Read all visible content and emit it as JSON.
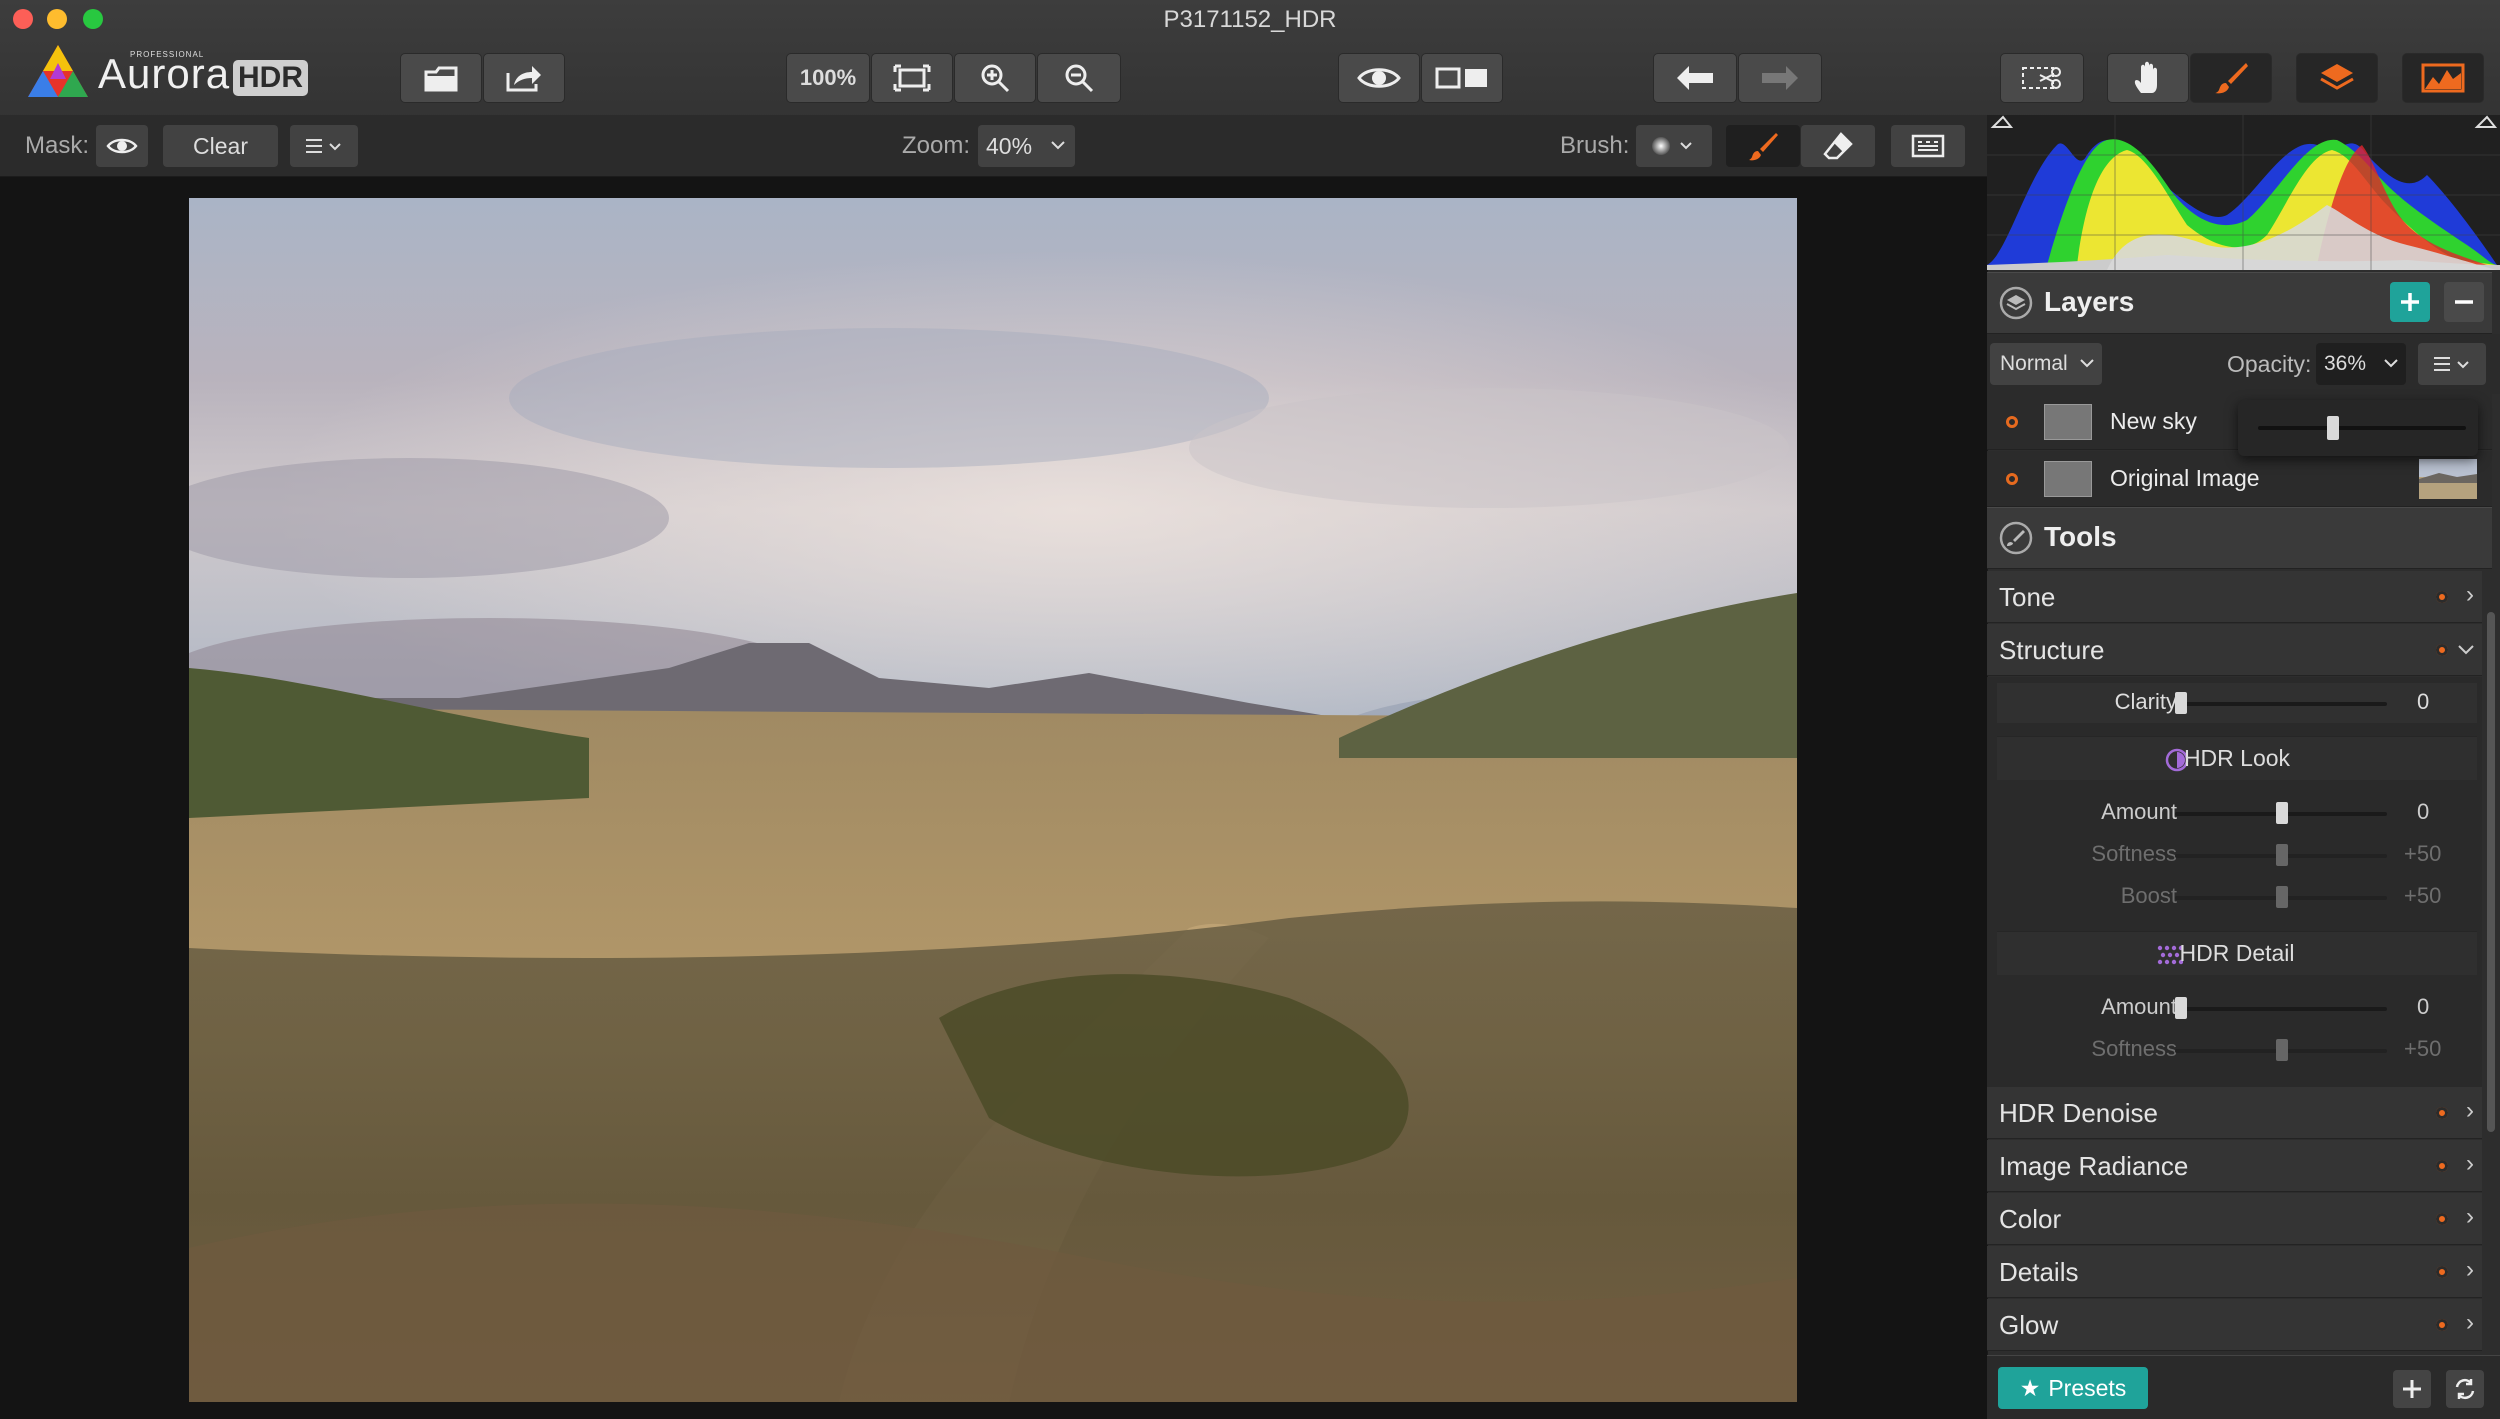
{
  "window": {
    "title": "P3171152_HDR"
  },
  "app": {
    "name": "Aurora",
    "badge": "HDR",
    "edition": "PROFESSIONAL"
  },
  "toolbar": {
    "zoom_100_label": "100%"
  },
  "options_bar": {
    "mask_label": "Mask:",
    "clear_label": "Clear",
    "zoom_label": "Zoom:",
    "zoom_value": "40%",
    "brush_label": "Brush:"
  },
  "layers": {
    "title": "Layers",
    "blend_mode": "Normal",
    "opacity_label": "Opacity:",
    "opacity_value": "36%",
    "opacity_slider_fraction": 0.36,
    "items": [
      {
        "name": "New sky"
      },
      {
        "name": "Original Image"
      }
    ]
  },
  "tools": {
    "title": "Tools",
    "sections": {
      "tone": "Tone",
      "structure": "Structure",
      "hdr_denoise": "HDR Denoise",
      "image_radiance": "Image Radiance",
      "color": "Color",
      "details": "Details",
      "glow": "Glow"
    },
    "structure": {
      "clarity": {
        "label": "Clarity",
        "value": "0"
      },
      "hdr_look": {
        "title": "HDR Look",
        "amount": {
          "label": "Amount",
          "value": "0"
        },
        "softness": {
          "label": "Softness",
          "value": "+50"
        },
        "boost": {
          "label": "Boost",
          "value": "+50"
        }
      },
      "hdr_detail": {
        "title": "HDR Detail",
        "amount": {
          "label": "Amount",
          "value": "0"
        },
        "softness": {
          "label": "Softness",
          "value": "+50"
        }
      }
    }
  },
  "presets": {
    "label": "Presets"
  },
  "colors": {
    "accent_teal": "#1fa39a",
    "orange": "#ee6a1f",
    "panel": "#2d2d2d"
  }
}
